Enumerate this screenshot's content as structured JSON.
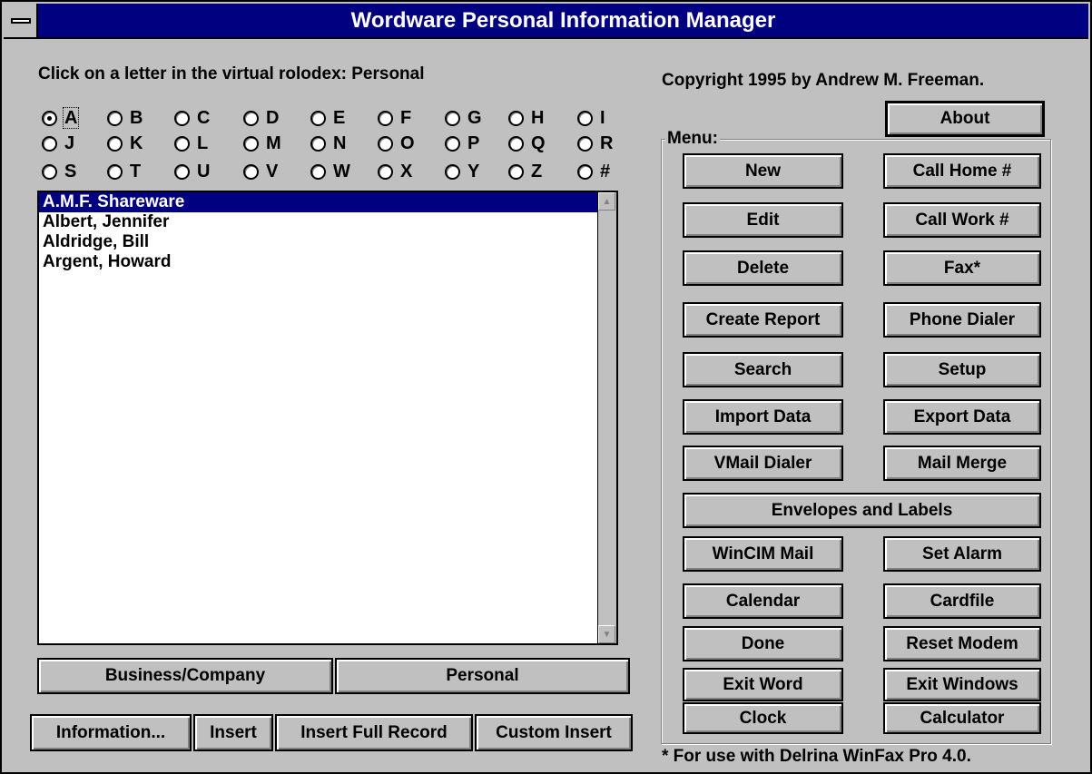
{
  "window": {
    "title": "Wordware Personal Information Manager"
  },
  "rolodex": {
    "prompt": "Click on a letter in the virtual rolodex:  Personal",
    "rows": [
      [
        {
          "letter": "A",
          "checked": true
        },
        {
          "letter": "B"
        },
        {
          "letter": "C"
        },
        {
          "letter": "D"
        },
        {
          "letter": "E"
        },
        {
          "letter": "F"
        },
        {
          "letter": "G"
        },
        {
          "letter": "H"
        },
        {
          "letter": "I"
        }
      ],
      [
        {
          "letter": "J"
        },
        {
          "letter": "K"
        },
        {
          "letter": "L"
        },
        {
          "letter": "M"
        },
        {
          "letter": "N"
        },
        {
          "letter": "O"
        },
        {
          "letter": "P"
        },
        {
          "letter": "Q"
        },
        {
          "letter": "R"
        }
      ],
      [
        {
          "letter": "S"
        },
        {
          "letter": "T"
        },
        {
          "letter": "U"
        },
        {
          "letter": "V"
        },
        {
          "letter": "W"
        },
        {
          "letter": "X"
        },
        {
          "letter": "Y"
        },
        {
          "letter": "Z"
        },
        {
          "letter": "#"
        }
      ]
    ]
  },
  "contacts": {
    "items": [
      "A.M.F. Shareware",
      "Albert, Jennifer",
      "Aldridge, Bill",
      "Argent, Howard"
    ],
    "selected_index": 0
  },
  "category_buttons": {
    "business": "Business/Company",
    "personal": "Personal"
  },
  "insert_buttons": {
    "information": "Information...",
    "insert": "Insert",
    "insert_full": "Insert Full Record",
    "custom_insert": "Custom Insert"
  },
  "copyright": "Copyright 1995 by Andrew M. Freeman.",
  "about_label": "About",
  "menu": {
    "label": "Menu:",
    "new": "New",
    "call_home": "Call Home #",
    "edit": "Edit",
    "call_work": "Call Work #",
    "delete": "Delete",
    "fax": "Fax*",
    "create_report": "Create Report",
    "phone_dialer": "Phone Dialer",
    "search": "Search",
    "setup": "Setup",
    "import_data": "Import Data",
    "export_data": "Export Data",
    "vmail_dialer": "VMail Dialer",
    "mail_merge": "Mail Merge",
    "envelopes_labels": "Envelopes and Labels",
    "wincim_mail": "WinCIM Mail",
    "set_alarm": "Set Alarm",
    "calendar": "Calendar",
    "cardfile": "Cardfile",
    "done": "Done",
    "reset_modem": "Reset Modem",
    "exit_word": "Exit Word",
    "exit_windows": "Exit Windows",
    "clock": "Clock",
    "calculator": "Calculator"
  },
  "footnote": "* For use with Delrina WinFax Pro 4.0.",
  "colors": {
    "titlebar": "#000080",
    "face": "#c0c0c0",
    "selection": "#000080"
  }
}
